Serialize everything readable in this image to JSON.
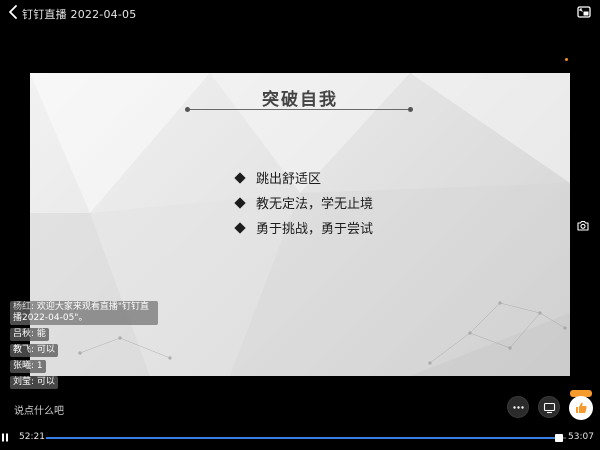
{
  "header": {
    "title": "钉钉直播 2022-04-05"
  },
  "slide": {
    "title": "突破自我",
    "bullets": [
      "跳出舒适区",
      "教无定法，学无止境",
      "勇于挑战，勇于尝试"
    ]
  },
  "chat": {
    "messages": [
      {
        "name": "杨红",
        "text": "欢迎大家来观看直播\"钉钉直播2022-04-05\"。"
      },
      {
        "name": "吕秋",
        "text": "能"
      },
      {
        "name": "教飞",
        "text": "可以"
      },
      {
        "name": "张曦",
        "text": "1"
      },
      {
        "name": "刘莹",
        "text": "可以"
      }
    ]
  },
  "comment": {
    "placeholder": "说点什么吧"
  },
  "player": {
    "current_time": "52:21",
    "duration": "53:07",
    "progress_fraction": 0.9856
  },
  "icons": {
    "back": "chevron-left-icon",
    "pip": "picture-in-picture-icon",
    "camera": "camera-icon",
    "more": "more-horizontal-icon",
    "screen": "cast-screen-icon",
    "like": "thumbs-up-icon",
    "pause": "pause-icon"
  },
  "colors": {
    "progress": "#3b7de8",
    "like_badge": "#f59a2c"
  }
}
